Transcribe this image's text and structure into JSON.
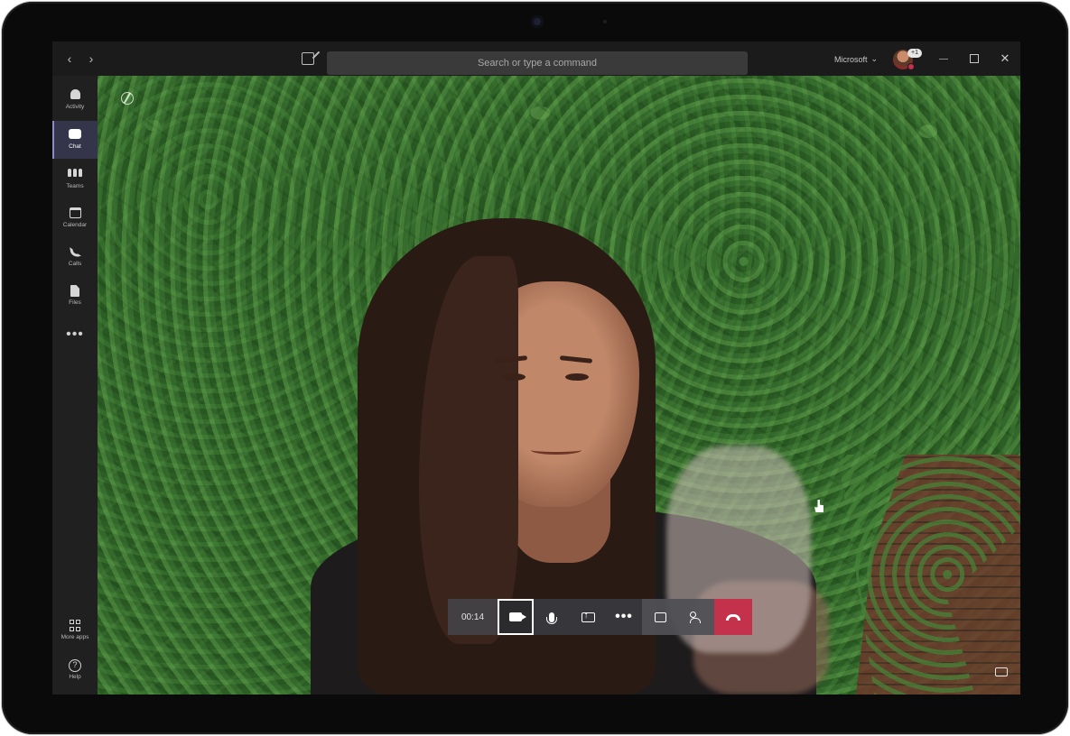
{
  "titlebar": {
    "back_icon": "chevron-left-icon",
    "forward_icon": "chevron-right-icon",
    "compose_icon": "compose-icon",
    "search_placeholder": "Search or type a command",
    "org_name": "Microsoft",
    "org_chevron": "⌄",
    "avatar_badge": "+1",
    "window_controls": [
      "minimize",
      "maximize",
      "close"
    ],
    "close_glyph": "✕"
  },
  "rail": {
    "items": [
      {
        "label": "Activity",
        "icon": "bell-icon",
        "active": false
      },
      {
        "label": "Chat",
        "icon": "chat-icon",
        "active": true
      },
      {
        "label": "Teams",
        "icon": "teams-icon",
        "active": false
      },
      {
        "label": "Calendar",
        "icon": "calendar-icon",
        "active": false
      },
      {
        "label": "Calls",
        "icon": "phone-icon",
        "active": false
      },
      {
        "label": "Files",
        "icon": "file-icon",
        "active": false
      }
    ],
    "more": "•••",
    "bottom": [
      {
        "label": "More apps",
        "icon": "apps-icon"
      },
      {
        "label": "Help",
        "icon": "help-icon"
      }
    ],
    "help_glyph": "?"
  },
  "call": {
    "timer": "00:14",
    "controls": [
      {
        "name": "camera",
        "icon": "video-camera-icon",
        "selected": true
      },
      {
        "name": "mic",
        "icon": "microphone-icon"
      },
      {
        "name": "share",
        "icon": "share-screen-icon"
      },
      {
        "name": "more",
        "icon": "more-options-icon",
        "glyph": "•••"
      },
      {
        "name": "chat",
        "icon": "chat-bubble-icon"
      },
      {
        "name": "participants",
        "icon": "participants-icon"
      },
      {
        "name": "hang-up",
        "icon": "hang-up-icon",
        "color": "#c4314b"
      }
    ]
  },
  "colors": {
    "accent": "#8b8cc7",
    "hangup": "#c4314b",
    "titlebar": "#1b1b1b",
    "rail": "#202021"
  }
}
